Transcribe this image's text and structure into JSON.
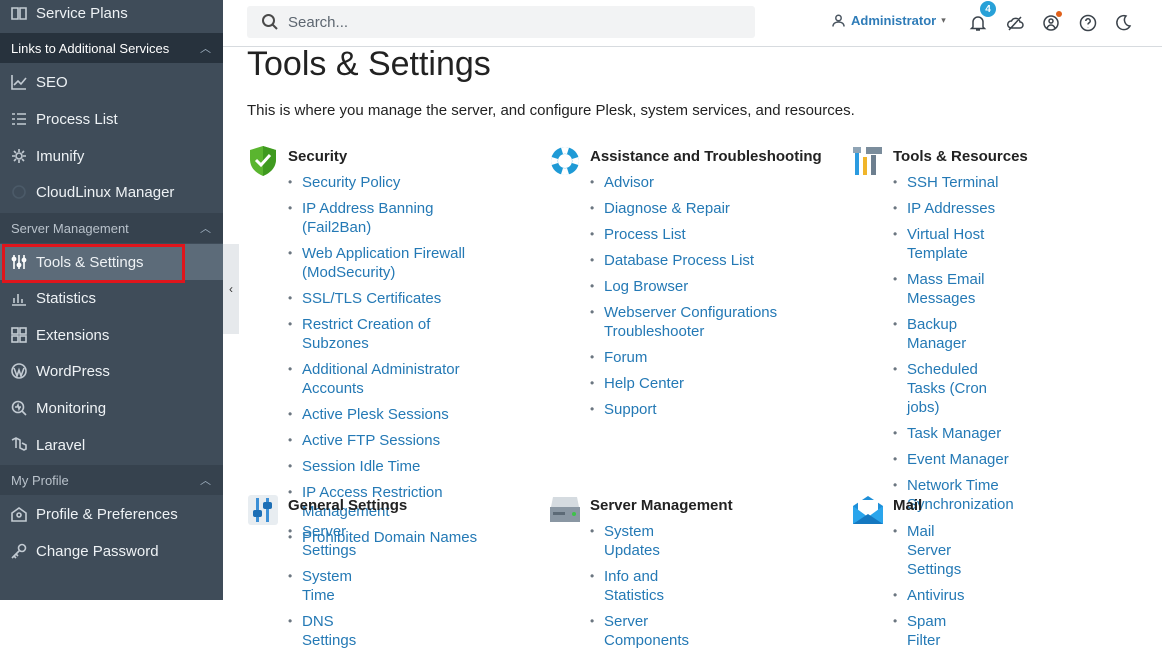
{
  "sidebar": {
    "top_item": "Service Plans",
    "section_links": "Links to Additional Services",
    "links_items": [
      "SEO",
      "Process List",
      "Imunify",
      "CloudLinux Manager"
    ],
    "section_server": "Server Management",
    "server_items": [
      "Tools & Settings",
      "Statistics",
      "Extensions",
      "WordPress",
      "Monitoring",
      "Laravel"
    ],
    "section_profile": "My Profile",
    "profile_items": [
      "Profile & Preferences",
      "Change Password"
    ]
  },
  "header": {
    "search_placeholder": "Search...",
    "user_name": "Administrator",
    "notifications_count": "4"
  },
  "main": {
    "title": "Tools & Settings",
    "description": "This is where you manage the server, and configure Plesk, system services, and resources."
  },
  "groups": {
    "security": {
      "title": "Security",
      "links": [
        "Security Policy",
        "IP Address Banning (Fail2Ban)",
        "Web Application Firewall (ModSecurity)",
        "SSL/TLS Certificates",
        "Restrict Creation of Subzones",
        "Additional Administrator Accounts",
        "Active Plesk Sessions",
        "Active FTP Sessions",
        "Session Idle Time",
        "IP Access Restriction Management",
        "Prohibited Domain Names"
      ]
    },
    "assistance": {
      "title": "Assistance and Troubleshooting",
      "links": [
        "Advisor",
        "Diagnose & Repair",
        "Process List",
        "Database Process List",
        "Log Browser",
        "Webserver Configurations Troubleshooter",
        "Forum",
        "Help Center",
        "Support"
      ]
    },
    "tools": {
      "title": "Tools & Resources",
      "links": [
        "SSH Terminal",
        "IP Addresses",
        "Virtual Host Template",
        "Mass Email Messages",
        "Backup Manager",
        "Scheduled Tasks (Cron jobs)",
        "Task Manager",
        "Event Manager",
        "Network Time Synchronization"
      ]
    },
    "general": {
      "title": "General Settings",
      "links": [
        "Server Settings",
        "System Time",
        "DNS Settings"
      ]
    },
    "server": {
      "title": "Server Management",
      "links": [
        "System Updates",
        "Info and Statistics",
        "Server Components"
      ]
    },
    "mail": {
      "title": "Mail",
      "links": [
        "Mail Server Settings",
        "Antivirus",
        "Spam Filter"
      ]
    }
  },
  "colors": {
    "link": "#2479b5",
    "sidebar_bg": "#3f4c59",
    "highlight": "#e0151c",
    "badge": "#28a1d8"
  }
}
